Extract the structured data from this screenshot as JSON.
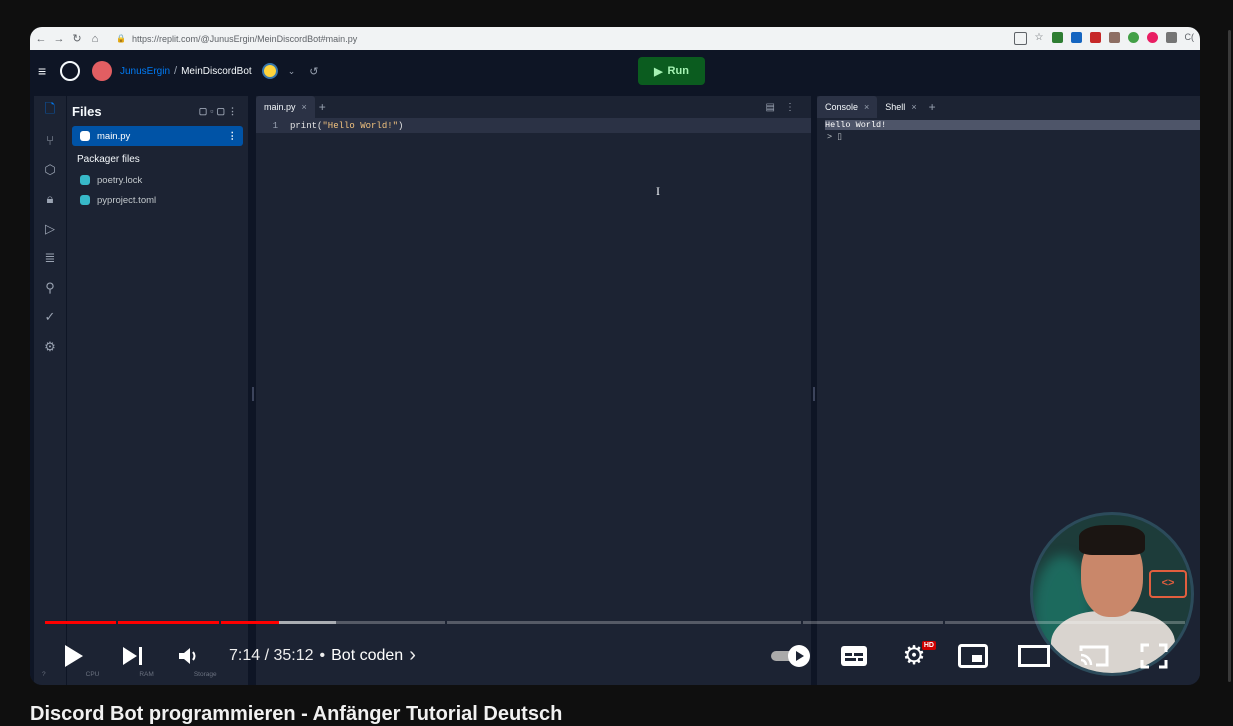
{
  "browser": {
    "url": "https://replit.com/@JunusErgin/MeinDiscordBot#main.py",
    "nav_icons": [
      "back-icon",
      "forward-icon",
      "reload-icon",
      "home-icon"
    ],
    "overflow_text": "C("
  },
  "app": {
    "user": "JunusErgin",
    "separator": "/",
    "repo": "MeinDiscordBot",
    "run_label": "Run",
    "accent_color": "#0079f2",
    "run_color": "#0b5c1f"
  },
  "sidebar": {
    "icons": [
      "files-icon",
      "version-control-icon",
      "packages-icon",
      "secrets-icon",
      "debugger-icon",
      "database-icon",
      "user-icon",
      "check-icon",
      "settings-icon"
    ]
  },
  "files": {
    "title": "Files",
    "items": [
      {
        "name": "main.py",
        "selected": true
      },
      {
        "name": "poetry.lock",
        "selected": false
      },
      {
        "name": "pyproject.toml",
        "selected": false
      }
    ],
    "section": "Packager files"
  },
  "editor": {
    "tab": "main.py",
    "line_number": "1",
    "code_prefix": "print(",
    "code_string": "\"Hello World!\"",
    "code_suffix": ")"
  },
  "console": {
    "tabs": [
      "Console",
      "Shell"
    ],
    "output": "Hello World!",
    "prompt": ">"
  },
  "video": {
    "time": "7:14 / 35:12",
    "chapter_sep": "•",
    "chapter": "Bot coden",
    "played_fraction": 0.205,
    "buffered_fraction": 0.255,
    "hd_badge": "HD",
    "title": "Discord Bot programmieren - Anfänger Tutorial Deutsch",
    "webcam_logo": "<>"
  },
  "status": {
    "help": "?",
    "cpu": "CPU",
    "ram": "RAM",
    "storage": "Storage"
  }
}
